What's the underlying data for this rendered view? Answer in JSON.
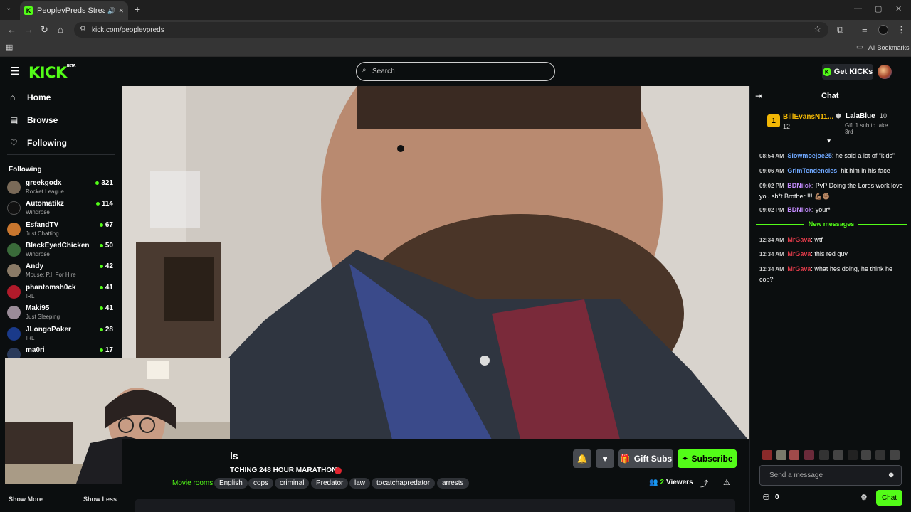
{
  "browser": {
    "tab_title": "PeoplevPreds Stream - Watch",
    "url": "kick.com/peoplevpreds",
    "bookmarks_label": "All Bookmarks"
  },
  "header": {
    "logo": "KICK",
    "logo_badge": "BETA",
    "search_placeholder": "Search",
    "get_kicks": "Get KICKs"
  },
  "sidebar": {
    "nav": [
      {
        "label": "Home"
      },
      {
        "label": "Browse"
      },
      {
        "label": "Following"
      }
    ],
    "following_heading": "Following",
    "following": [
      {
        "name": "greekgodx",
        "category": "Rocket League",
        "viewers": "321",
        "color": "#7a6a58"
      },
      {
        "name": "Automatikz",
        "category": "Windrose",
        "viewers": "114",
        "color": "#111111"
      },
      {
        "name": "EsfandTV",
        "category": "Just Chatting",
        "viewers": "67",
        "color": "#c9762e"
      },
      {
        "name": "BlackEyedChicken",
        "category": "Windrose",
        "viewers": "50",
        "color": "#3a6b3a"
      },
      {
        "name": "Andy",
        "category": "Mouse: P.I. For Hire",
        "viewers": "42",
        "color": "#8a7a66"
      },
      {
        "name": "phantomsh0ck",
        "category": "IRL",
        "viewers": "41",
        "color": "#b01a2a"
      },
      {
        "name": "Maki95",
        "category": "Just Sleeping",
        "viewers": "41",
        "color": "#9a8c98"
      },
      {
        "name": "JLongoPoker",
        "category": "IRL",
        "viewers": "28",
        "color": "#1a3a8a"
      },
      {
        "name": "ma0ri",
        "category": "",
        "viewers": "17",
        "color": "#2a3a5a"
      }
    ],
    "show_more": "Show More",
    "show_less": "Show Less"
  },
  "stream": {
    "title_fragment": "ls",
    "subtitle": "TCHING 248 HOUR MARATHON",
    "category": "Movie rooms",
    "tags": [
      "English",
      "cops",
      "criminal",
      "Predator",
      "law",
      "tocatchapredator",
      "arrests"
    ],
    "gift_subs": "Gift Subs",
    "subscribe": "Subscribe",
    "viewers_count": "2",
    "viewers_label": "Viewers"
  },
  "chat": {
    "title": "Chat",
    "leaderboard": {
      "first_rank": "1",
      "first_name": "BillEvansN11...",
      "first_count": "12",
      "second_name": "LalaBlue",
      "second_count": "10",
      "second_note": "Gift 1 sub to take 3rd"
    },
    "messages": [
      {
        "time": "08:54 AM",
        "user": "Slowmoejoe25",
        "color": "#6fa8ff",
        "text": "he said a lot of “kids”"
      },
      {
        "time": "09:06 AM",
        "user": "GrimTendencies",
        "color": "#6fa8ff",
        "text": "hit him in his face"
      },
      {
        "time": "09:02 PM",
        "user": "BDNiick",
        "color": "#c48cff",
        "text": "PvP Doing the Lords work love you sh*t Brother !!! 💪🏽✊🏽"
      },
      {
        "time": "09:02 PM",
        "user": "BDNiick",
        "color": "#c48cff",
        "text": "your*"
      },
      {
        "time": "12:34 AM",
        "user": "MrGava",
        "color": "#e23b4a",
        "text": "wtf"
      },
      {
        "time": "12:34 AM",
        "user": "MrGava",
        "color": "#e23b4a",
        "text": "this red guy"
      },
      {
        "time": "12:34 AM",
        "user": "MrGava",
        "color": "#e23b4a",
        "text": "what hes doing, he think he cop?"
      }
    ],
    "new_messages": "New messages",
    "send_placeholder": "Send a message",
    "kicks_count": "0",
    "chat_button": "Chat"
  },
  "colors": {
    "accent": "#53fc18",
    "background": "#0b0e0f"
  }
}
